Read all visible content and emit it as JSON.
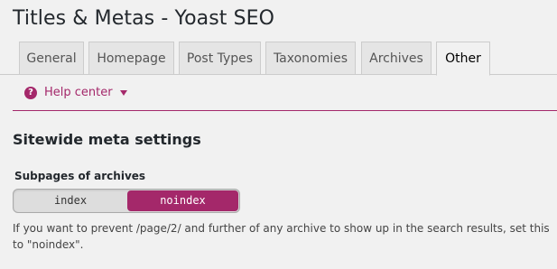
{
  "header": {
    "title": "Titles & Metas - Yoast SEO"
  },
  "tabs": [
    {
      "label": "General",
      "active": false
    },
    {
      "label": "Homepage",
      "active": false
    },
    {
      "label": "Post Types",
      "active": false
    },
    {
      "label": "Taxonomies",
      "active": false
    },
    {
      "label": "Archives",
      "active": false
    },
    {
      "label": "Other",
      "active": true
    }
  ],
  "help": {
    "icon_symbol": "?",
    "label": "Help center",
    "icon": "question-circle-icon",
    "chevron": "chevron-down-icon"
  },
  "section": {
    "title": "Sitewide meta settings"
  },
  "field": {
    "label": "Subpages of archives",
    "options": [
      "index",
      "noindex"
    ],
    "selected": "noindex",
    "description": "If you want to prevent /page/2/ and further of any archive to show up in the search results, set this to \"noindex\"."
  },
  "colors": {
    "accent": "#a4286a",
    "background": "#f1f1f1",
    "tab_inactive": "#e5e5e5",
    "switch_off": "#dddddd"
  }
}
